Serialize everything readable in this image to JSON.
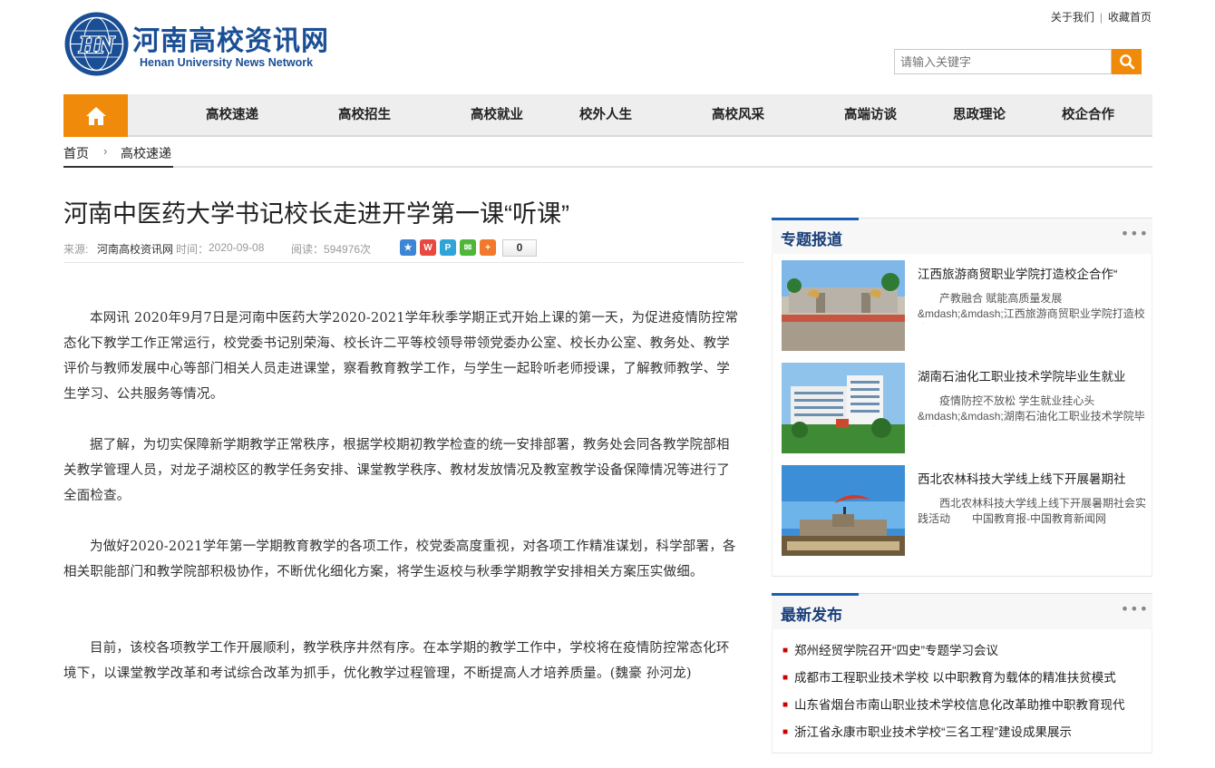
{
  "site": {
    "name_cn": "河南高校资讯网",
    "name_en": "Henan University News Network",
    "emblem_text": "HN"
  },
  "toplinks": {
    "about": "关于我们",
    "separator": "|",
    "favorite": "收藏首页"
  },
  "search": {
    "placeholder": "请输入关键字",
    "icon": "search-icon"
  },
  "nav": {
    "home_icon": "home-icon",
    "items": [
      "高校速递",
      "高校招生",
      "高校就业",
      "校外人生",
      "高校风采",
      "高端访谈",
      "思政理论",
      "校企合作"
    ]
  },
  "breadcrumb": {
    "home": "首页",
    "separator": "›",
    "current": "高校速递"
  },
  "article": {
    "title": "河南中医药大学书记校长走进开学第一课“听课”",
    "source_label": "来源:",
    "source": "河南高校资讯网",
    "time_label": "时间：",
    "time": "2020-09-08",
    "reads_label": "阅读：",
    "reads": "594976次",
    "share_count": "0",
    "paragraphs": [
      "本网讯 2020年9月7日是河南中医药大学2020-2021学年秋季学期正式开始上课的第一天，为促进疫情防控常态化下教学工作正常运行，校党委书记别荣海、校长许二平等校领导带领党委办公室、校长办公室、教务处、教学评价与教师发展中心等部门相关人员走进课堂，察看教育教学工作，与学生一起聆听老师授课，了解教师教学、学生学习、公共服务等情况。",
      "据了解，为切实保障新学期教学正常秩序，根据学校期初教学检查的统一安排部署，教务处会同各教学院部相关教学管理人员，对龙子湖校区的教学任务安排、课堂教学秩序、教材发放情况及教室教学设备保障情况等进行了全面检查。",
      "为做好2020-2021学年第一学期教育教学的各项工作，校党委高度重视，对各项工作精准谋划，科学部署，各相关职能部门和教学院部积极协作，不断优化细化方案，将学生返校与秋季学期教学安排相关方案压实做细。",
      "目前，该校各项教学工作开展顺利，教学秩序井然有序。在本学期的教学工作中，学校将在疫情防控常态化环境下，以课堂教学改革和考试综合改革为抓手，优化教学过程管理，不断提高人才培养质量。(魏豪 孙河龙)"
    ]
  },
  "sidebar": {
    "special": {
      "title": "专题报道",
      "more": "•••",
      "items": [
        {
          "title": "江西旅游商贸职业学院打造校企合作“",
          "summary": "产教融合 赋能高质量发展 &mdash;&mdash;江西旅游商贸职业学院打造校企合作&mdash;"
        },
        {
          "title": "湖南石油化工职业技术学院毕业生就业",
          "summary": "疫情防控不放松 学生就业挂心头 &mdash;&mdash;湖南石油化工职业技术学院毕业生"
        },
        {
          "title": "西北农林科技大学线上线下开展暑期社",
          "summary": "西北农林科技大学线上线下开展暑期社会实践活动　　中国教育报-中国教育新闻网"
        }
      ]
    },
    "latest": {
      "title": "最新发布",
      "more": "•••",
      "items": [
        "郑州经贸学院召开“四史”专题学习会议",
        "成都市工程职业技术学校 以中职教育为载体的精准扶贫模式",
        "山东省烟台市南山职业技术学校信息化改革助推中职教育现代",
        "浙江省永康市职业技术学校“三名工程”建设成果展示"
      ]
    }
  },
  "colors": {
    "brand_blue": "#1a4f96",
    "accent_orange": "#f08a0a",
    "nav_bg": "#eeeeee"
  }
}
